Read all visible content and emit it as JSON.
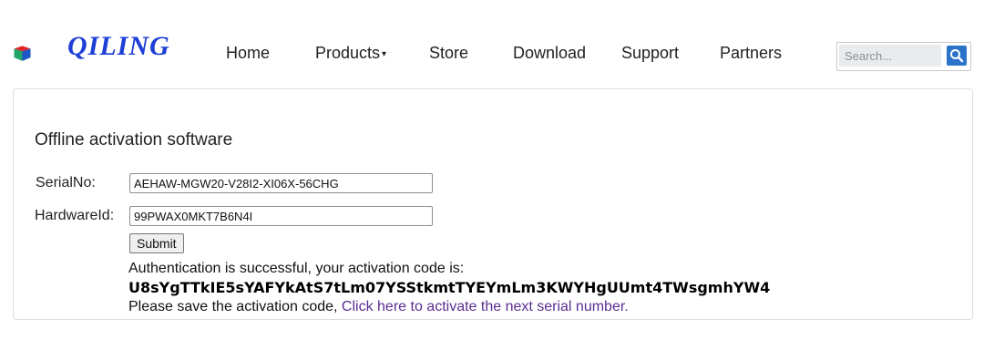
{
  "logo": {
    "text": "QILING"
  },
  "nav": [
    {
      "label": "Home"
    },
    {
      "label": "Products"
    },
    {
      "label": "Store"
    },
    {
      "label": "Download"
    },
    {
      "label": "Support"
    },
    {
      "label": "Partners"
    }
  ],
  "search": {
    "placeholder": "Search..."
  },
  "page": {
    "title": "Offline activation software",
    "serial_label": "SerialNo:",
    "serial_value": "AEHAW-MGW20-V28I2-XI06X-56CHG",
    "hardware_label": "HardwareId:",
    "hardware_value": "99PWAX0MKT7B6N4I",
    "submit_label": "Submit",
    "success_msg": "Authentication is successful, your activation code is:",
    "activation_code": "U8sYgTTkIE5sYAFYkAtS7tLm07YSStkmtTYEYmLm3KWYHgUUmt4TWsgmhYW4",
    "save_msg": "Please save the activation code, ",
    "next_link": "Click here to activate the next serial number."
  },
  "colors": {
    "logo_blue": "#1d3fd6",
    "search_button": "#2b73c9",
    "link": "#5b2d91"
  }
}
